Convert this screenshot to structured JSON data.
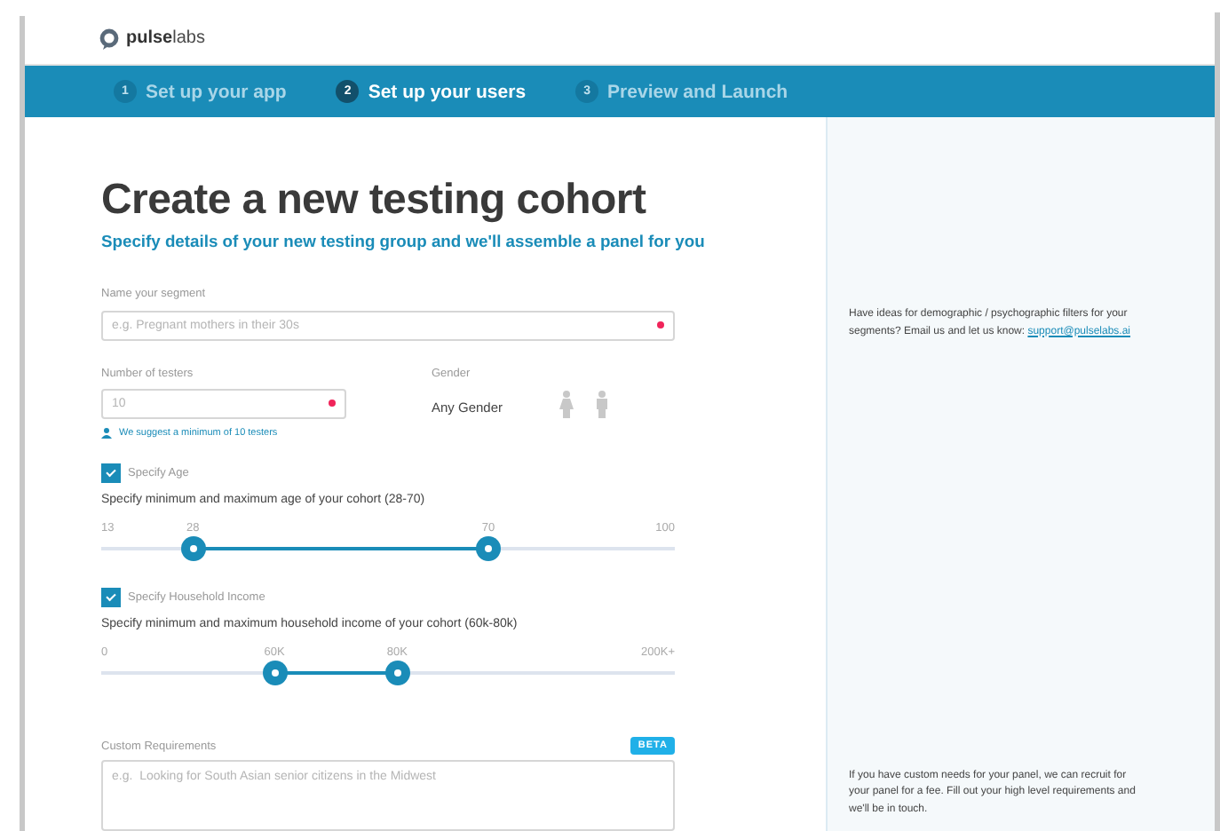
{
  "brand": {
    "name_bold": "pulse",
    "name_light": "labs"
  },
  "steps": [
    {
      "number": "1",
      "label": "Set up your app",
      "selected": false
    },
    {
      "number": "2",
      "label": "Set up your users",
      "selected": true
    },
    {
      "number": "3",
      "label": "Preview and Launch",
      "selected": false
    }
  ],
  "title": "Create a new testing cohort",
  "subtitle": "Specify details of your new testing group and we'll assemble a panel for you",
  "segment": {
    "label": "Name your segment",
    "placeholder": "e.g. Pregnant mothers in their 30s",
    "required": true
  },
  "testers": {
    "label": "Number of testers",
    "placeholder": "10",
    "required": true,
    "hint": "We suggest a minimum of 10 testers"
  },
  "gender": {
    "label": "Gender",
    "value": "Any Gender"
  },
  "ranges": [
    {
      "checkbox": "Specify Age",
      "checked": true,
      "description": "Specify minimum and maximum age of your cohort  (28-70)",
      "min_label": "13",
      "max_label": "100",
      "thumbs": [
        {
          "label": "28",
          "level": 0.16
        },
        {
          "label": "70",
          "level": 0.675
        }
      ]
    },
    {
      "checkbox": "Specify Household Income",
      "checked": true,
      "description": "Specify minimum and maximum household income of your cohort  (60k-80k)",
      "min_label": "0",
      "max_label": "200K+",
      "thumbs": [
        {
          "label": "60K",
          "level": 0.302
        },
        {
          "label": "80K",
          "level": 0.516
        }
      ]
    }
  ],
  "custom": {
    "label": "Custom Requirements",
    "badge": "BETA",
    "placeholder": "e.g.  Looking for South Asian senior citizens in the Midwest"
  },
  "side": {
    "ideas": "Have ideas for demographic / psychographic filters for your segments?  Email us and let us know: ",
    "email": "support@pulselabs.ai",
    "custom_note": "If you have custom needs for your panel, we can recruit for your panel for a fee.  Fill out your high level requirements and we'll be in touch."
  }
}
